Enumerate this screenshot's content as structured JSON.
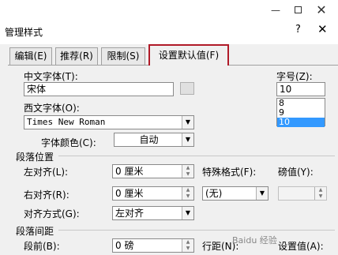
{
  "window": {
    "minimize": "—",
    "close": "✕"
  },
  "dialog": {
    "title": "管理样式",
    "help": "?",
    "close": "✕"
  },
  "tabs": [
    {
      "label": "编辑(E)"
    },
    {
      "label": "推荐(R)"
    },
    {
      "label": "限制(S)"
    },
    {
      "label": "设置默认值(F)"
    }
  ],
  "font": {
    "cn_label": "中文字体(T):",
    "cn_value": "宋体",
    "west_label": "西文字体(O):",
    "west_value": "Times New Roman",
    "color_label": "字体颜色(C):",
    "color_value": "自动",
    "size_label": "字号(Z):",
    "size_value": "10",
    "size_options": [
      "8",
      "9",
      "10"
    ],
    "size_selected": "10"
  },
  "paragraph": {
    "position_title": "段落位置",
    "left_label": "左对齐(L):",
    "left_value": "0 厘米",
    "special_label": "特殊格式(F):",
    "by_label": "磅值(Y):",
    "right_label": "右对齐(R):",
    "right_value": "0 厘米",
    "special_value": "(无)",
    "align_label": "对齐方式(G):",
    "align_value": "左对齐",
    "spacing_title": "段落间距",
    "before_label": "段前(B):",
    "before_value": "0 磅",
    "line_label": "行距(N):",
    "line_value_label": "设置值(A):"
  },
  "watermark": "Baidu 经验"
}
